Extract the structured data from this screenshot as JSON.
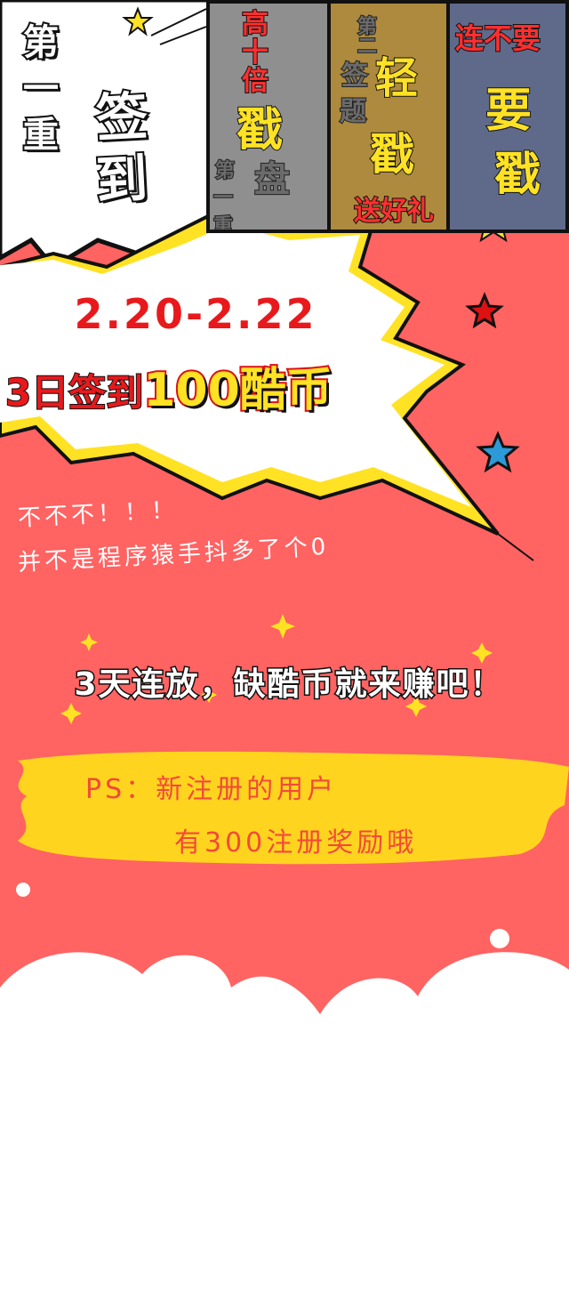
{
  "header": {
    "title_small": [
      "第",
      "一",
      "重"
    ],
    "title_big": [
      "签",
      "到"
    ]
  },
  "comic_panels": [
    {
      "lines": [
        "高十倍",
        "戳",
        "第",
        "一重",
        "盘"
      ]
    },
    {
      "lines": [
        "第",
        "二",
        "签",
        "轻",
        "题",
        "戳",
        "送好礼"
      ]
    },
    {
      "lines": [
        "连不要",
        "要",
        "戳"
      ]
    }
  ],
  "burst": {
    "date": "2.20-2.22",
    "sign_prefix": "3日签到",
    "sign_reward": "100酷币"
  },
  "note": {
    "line1": "不不不！！！",
    "line2": "并不是程序猿手抖多了个0"
  },
  "slogan": "3天连放，缺酷币就来赚吧！",
  "ps": {
    "line1": "PS：新注册的用户",
    "line2": "有300注册奖励哦"
  },
  "colors": {
    "background": "#ff6362",
    "burst_yellow": "#ffe224",
    "date_red": "#e8191c",
    "star_blue": "#2c9ad8"
  }
}
